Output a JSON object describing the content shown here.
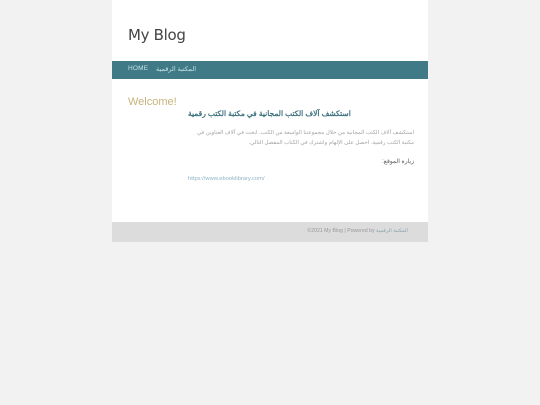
{
  "header": {
    "site_title": "My Blog"
  },
  "nav": {
    "home": "HOME",
    "library": "المكتبة الرقمية"
  },
  "sidebar": {
    "welcome": "Welcome!"
  },
  "post": {
    "title": "استكشف آلاف الكتب المجانية في مكتبة الكتب رقمية",
    "body": "استكشف آلاف الكتب المجانية من خلال مجموعتنا الواسعة من الكتب. ابحث في آلاف العناوين في مكتبة الكتب رقمية. احصل على الإلهام واشترك في الكتاب المفضل التالي.",
    "visit_label": "زيارة الموقع:",
    "url": "https://www.ebooklibrary.com/"
  },
  "footer": {
    "copyright": "©2021 My Blog",
    "separator": "|",
    "powered_by": "Powered by",
    "powered_link": "المكتبة الرقمية"
  }
}
